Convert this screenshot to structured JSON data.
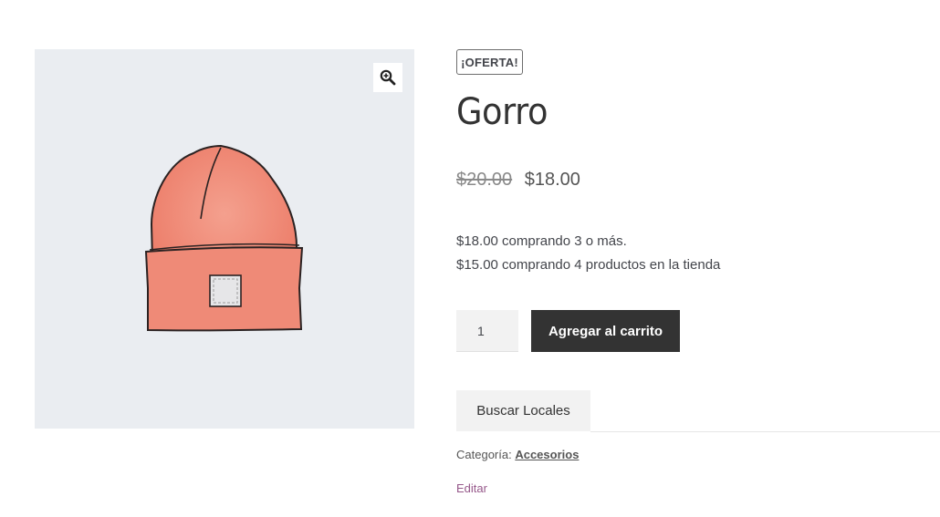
{
  "product": {
    "sale_badge": "¡OFERTA!",
    "title": "Gorro",
    "regular_price": "$20.00",
    "sale_price": "$18.00",
    "tier_prices": [
      "$18.00 comprando 3 o más.",
      "$15.00 comprando 4 productos en la tienda"
    ],
    "quantity": "1",
    "add_to_cart_label": "Agregar al carrito",
    "tab_label": "Buscar Locales",
    "category_label": "Categoría:",
    "category_value": "Accesorios",
    "edit_label": "Editar"
  },
  "gallery": {
    "zoom_icon": "magnifier-zoom-icon",
    "image": "beanie-hat-image",
    "background_color": "#eaedf1"
  },
  "colors": {
    "button_bg": "#333333",
    "link_accent": "#96588a",
    "hat": "#f08a78"
  }
}
